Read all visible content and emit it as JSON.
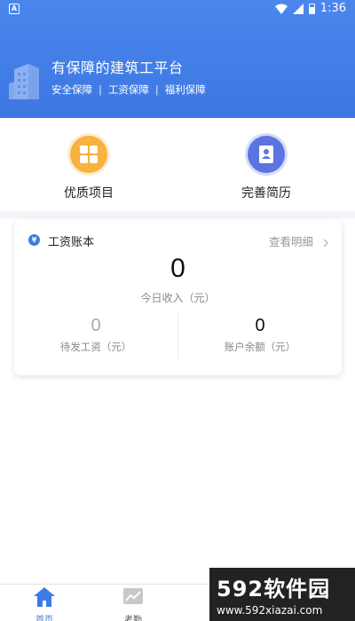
{
  "status_bar": {
    "time": "1:36",
    "app_badge": "A"
  },
  "header": {
    "slogan": "有保障的建筑工平台",
    "features": [
      "安全保障",
      "工资保障",
      "福利保障"
    ],
    "feature_separator": "|"
  },
  "quick_actions": [
    {
      "label": "优质项目",
      "icon": "grid-icon",
      "color": "#f7b23f"
    },
    {
      "label": "完善简历",
      "icon": "resume-icon",
      "color": "#5b74e0"
    }
  ],
  "salary_card": {
    "currency_symbol": "¥",
    "title": "工资账本",
    "detail_link": "查看明细",
    "today_income_value": "0",
    "today_income_label": "今日收入（元）",
    "pending_wage_value": "0",
    "pending_wage_label": "待发工资（元）",
    "balance_value": "0",
    "balance_label": "账户余额（元）"
  },
  "bottom_nav": [
    {
      "label": "首页",
      "icon": "home-icon",
      "active": true
    },
    {
      "label": "考勤",
      "icon": "attendance-chart-icon",
      "active": false
    }
  ],
  "watermark": {
    "brand_number": "592",
    "brand_text": "软件园",
    "url": "www.592xiazai.com"
  },
  "colors": {
    "primary": "#3d7be6",
    "header_bg": "#4a86ec",
    "orange": "#f7b23f",
    "indigo": "#5b74e0"
  }
}
